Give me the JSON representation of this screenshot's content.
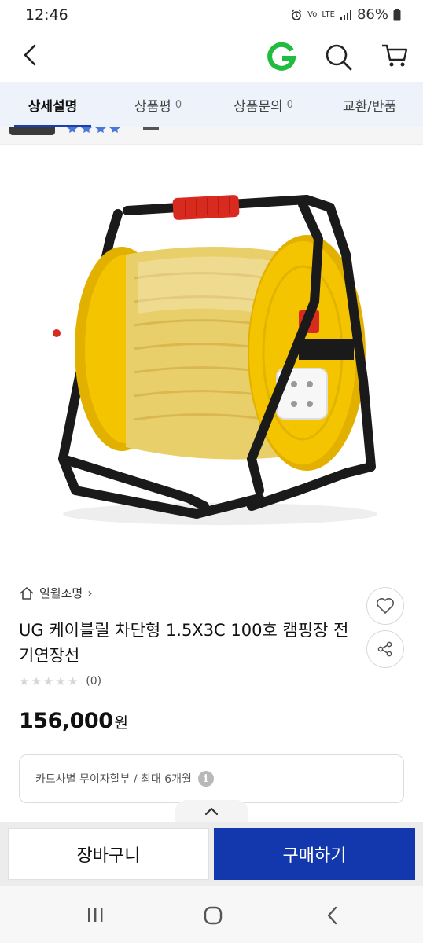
{
  "status_bar": {
    "time": "12:46",
    "network_label": "LTE",
    "volte_label": "Vo",
    "battery": "86%"
  },
  "tabs": [
    {
      "label": "상세설명",
      "count": "",
      "active": true
    },
    {
      "label": "상품평",
      "count": "0",
      "active": false
    },
    {
      "label": "상품문의",
      "count": "0",
      "active": false
    },
    {
      "label": "교환/반품",
      "count": "",
      "active": false
    }
  ],
  "product": {
    "brand": "일월조명",
    "title": "UG 케이블릴 차단형 1.5X3C 100호 캠핑장 전기연장선",
    "rating_count": "(0)",
    "rating_value": 0,
    "price": "156,000",
    "price_unit": "원",
    "installment": "카드사별 무이자할부 / 최대 6개월"
  },
  "buy_bar": {
    "cart_label": "장바구니",
    "buy_label": "구매하기"
  },
  "colors": {
    "accent": "#1338ad",
    "tab_bg": "#eef3fb",
    "reel_yellow": "#f5c400",
    "frame_black": "#1a1a1a",
    "handle_red": "#d92a1f",
    "logo_green": "#1fbc3d"
  },
  "icons": [
    "back-icon",
    "g-logo",
    "search-icon",
    "cart-icon",
    "home-icon",
    "heart-icon",
    "share-icon",
    "info-icon",
    "chevron-up-icon",
    "recents-icon",
    "home-circle-icon",
    "nav-back-icon"
  ]
}
